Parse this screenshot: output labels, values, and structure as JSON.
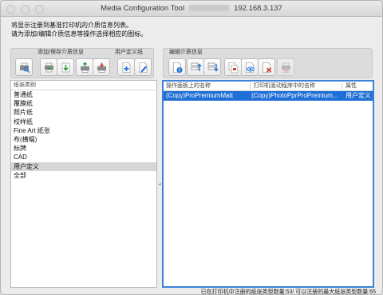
{
  "window": {
    "title_prefix": "Media Configuration Tool",
    "title_ip": "192.168.3.137"
  },
  "intro": {
    "line1": "将显示注册到基准打印机的介质信息列表。",
    "line2": "请为添加/编辑介质信息等操作选择相应的图标。"
  },
  "toolbar": {
    "add_save_label": "添加/保存介质信息",
    "custom_paper_label": "用户定义纸",
    "edit_label": "编辑介质信息"
  },
  "left_list": {
    "header": "纸张类别",
    "items": [
      "普通纸",
      "覆膜纸",
      "照片纸",
      "校样纸",
      "Fine Art 纸张",
      "布(横幅)",
      "标牌",
      "CAD",
      "用户定义",
      "全部"
    ],
    "selected": "用户定义"
  },
  "right_table": {
    "columns": [
      "操作面板上的名称",
      "打印机驱动程序中的名称",
      "属性"
    ],
    "rows": [
      {
        "panel_name": "(Copy)ProPremiumMatt",
        "driver_name": "(Copy)PhotoPprProPremium...",
        "attribute": "用户定义"
      }
    ]
  },
  "status": {
    "text": "已在打印机中注册的纸张类型数量:53/ 可以注册的最大纸张类型数量:65"
  },
  "colors": {
    "selection": "#1f6fd6",
    "panel_focus_border": "#3b82d8"
  }
}
